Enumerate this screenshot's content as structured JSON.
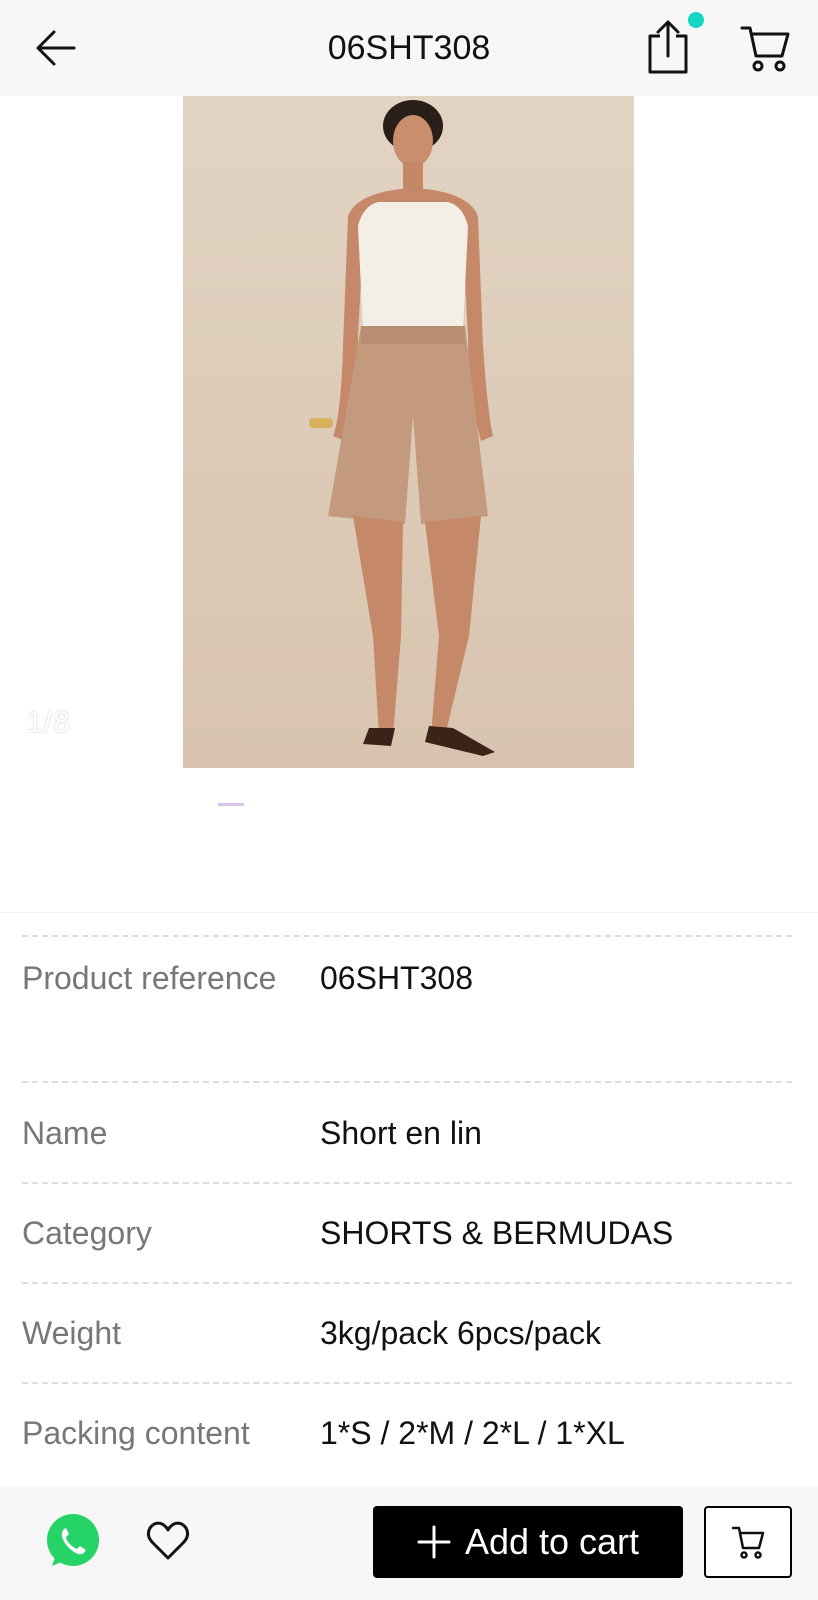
{
  "header": {
    "title": "06SHT308",
    "icons": {
      "back": "back-arrow-icon",
      "share": "share-icon",
      "cart": "cart-icon"
    },
    "notification_dot_color": "#14d6c2"
  },
  "gallery": {
    "pager": "1/8",
    "image_description_icon": "product-photo"
  },
  "specs": [
    {
      "label": "Product reference",
      "value": "06SHT308"
    },
    {
      "label": "Name",
      "value": "Short en lin"
    },
    {
      "label": "Category",
      "value": "SHORTS & BERMUDAS"
    },
    {
      "label": "Weight",
      "value": "3kg/pack 6pcs/pack"
    },
    {
      "label": "Packing content",
      "value": "1*S / 2*M / 2*L / 1*XL"
    }
  ],
  "bottom_bar": {
    "add_to_cart_label": "Add to cart",
    "whatsapp_color": "#25d366",
    "icons": {
      "whatsapp": "whatsapp-icon",
      "favorite": "heart-icon",
      "plus": "plus-icon",
      "cart": "cart-icon"
    }
  }
}
